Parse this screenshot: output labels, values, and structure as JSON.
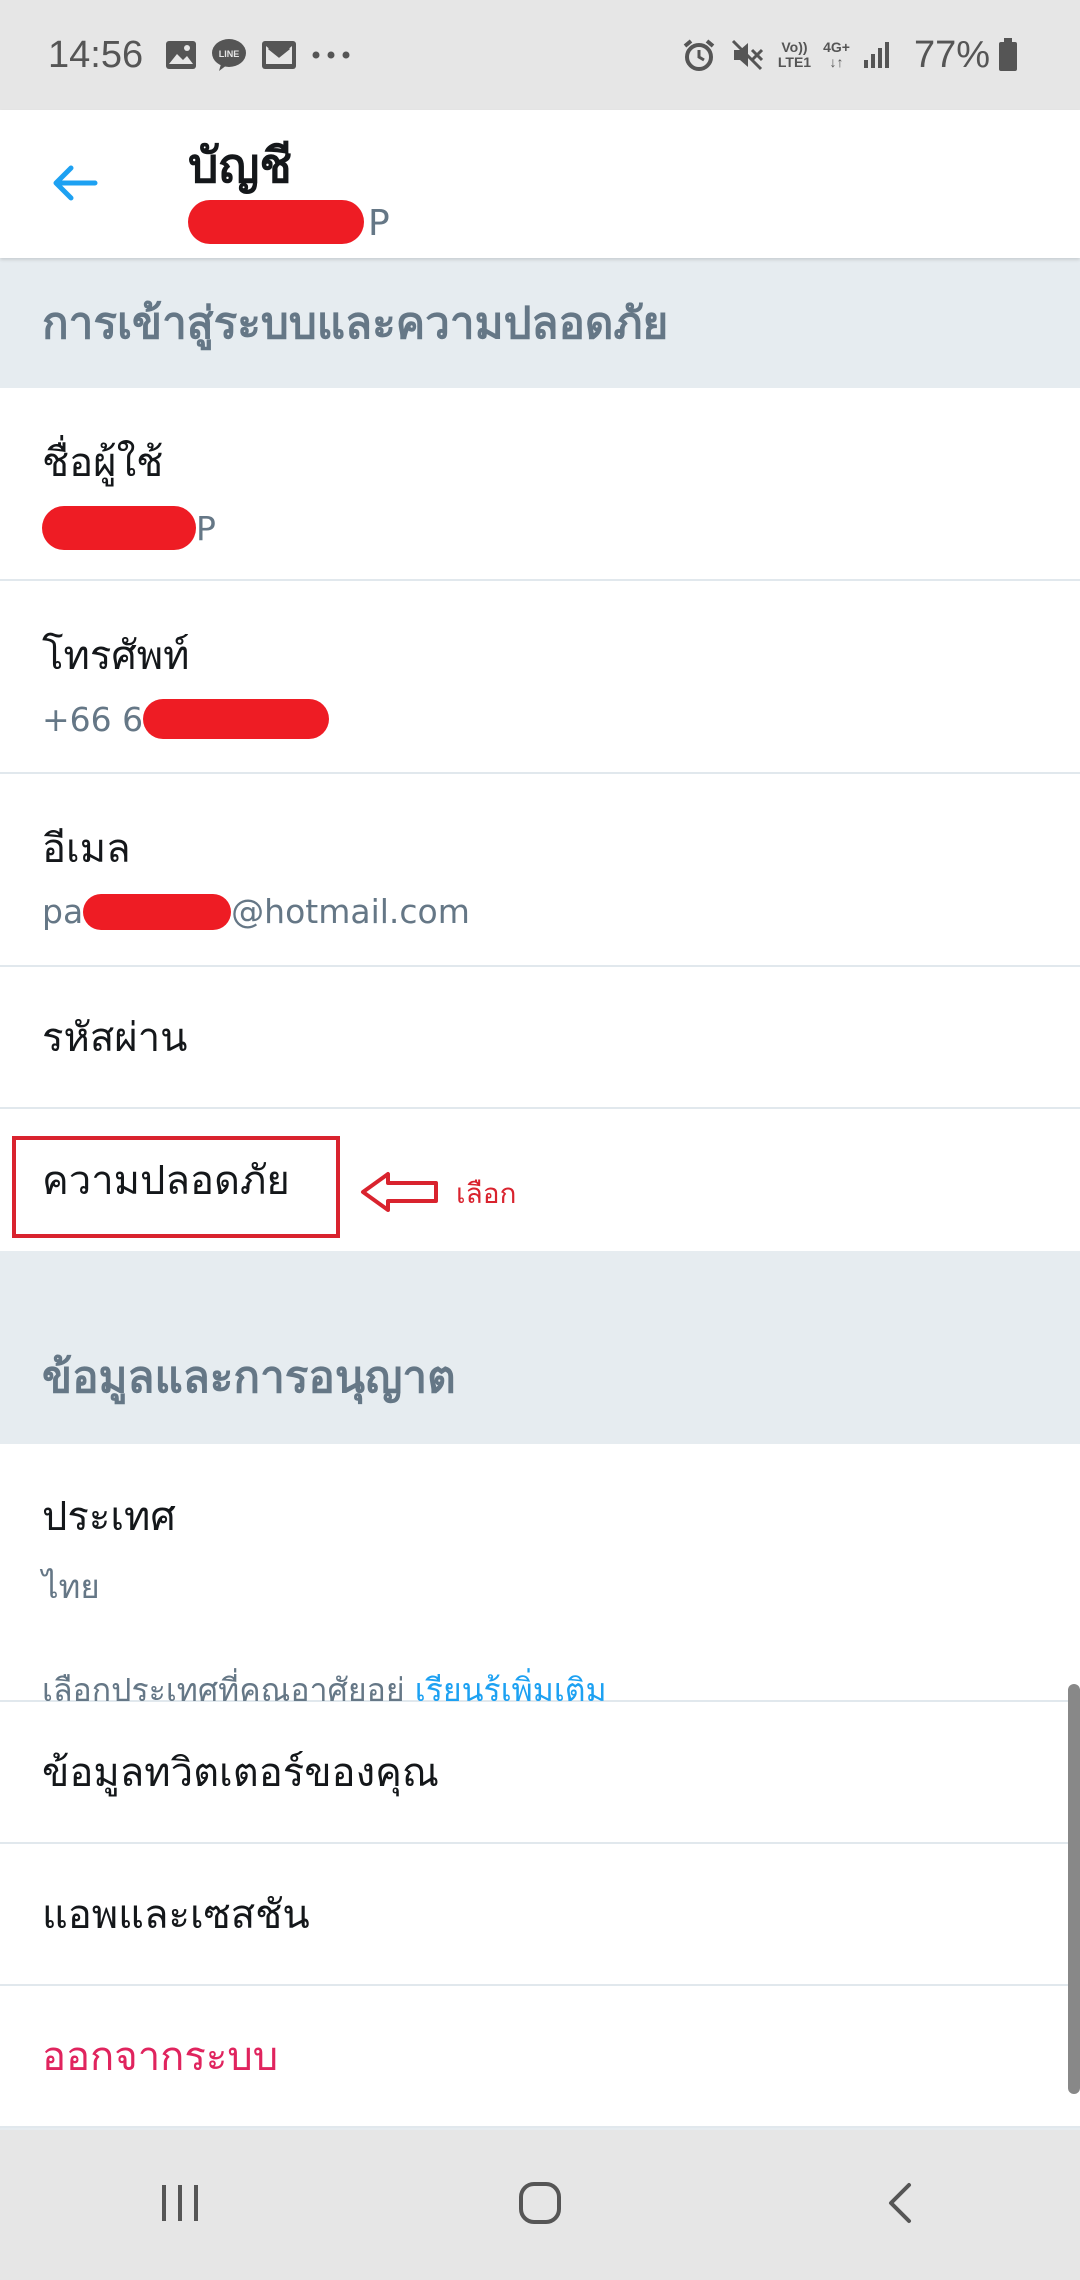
{
  "status_bar": {
    "time": "14:56",
    "notification_icons": [
      "image-icon",
      "line-app-icon",
      "mail-icon",
      "more-dots-icon"
    ],
    "system_icons": [
      "alarm-icon",
      "mute-icon",
      "volte-icon",
      "4g-icon",
      "signal-icon"
    ],
    "network_line1": "Vo))",
    "network_line2": "LTE1",
    "network_4g": "4G+",
    "battery_percent": "77%"
  },
  "app_bar": {
    "title": "บัญชี",
    "username_suffix": "P"
  },
  "sections": {
    "login_security": {
      "header": "การเข้าสู่ระบบและความปลอดภัย",
      "username_label": "ชื่อผู้ใช้",
      "username_suffix": "P",
      "phone_label": "โทรศัพท์",
      "phone_prefix": "+66 6",
      "email_label": "อีเมล",
      "email_prefix": "pa",
      "email_suffix": "@hotmail.com",
      "password_label": "รหัสผ่าน",
      "security_label": "ความปลอดภัย"
    },
    "data_permissions": {
      "header": "ข้อมูลและการอนุญาต",
      "country_label": "ประเทศ",
      "country_value": "ไทย",
      "country_note": "เลือกประเทศที่คุณอาศัยอยู่",
      "learn_more": "เรียนรู้เพิ่มเติม",
      "twitter_data_label": "ข้อมูลทวิตเตอร์ของคุณ",
      "apps_sessions_label": "แอพและเซสชัน",
      "logout_label": "ออกจากระบบ"
    }
  },
  "annotation": {
    "label": "เลือก"
  },
  "colors": {
    "accent": "#1da1f2",
    "secondary_text": "#657786",
    "logout": "#e0245e",
    "annotation": "#d9232e",
    "redaction": "#ee1c24"
  },
  "nav_bar": {
    "buttons": [
      "recents-icon",
      "home-icon",
      "back-nav-icon"
    ]
  }
}
